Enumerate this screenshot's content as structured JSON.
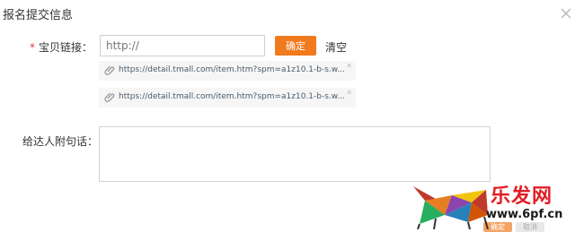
{
  "dialog": {
    "title": "报名提交信息"
  },
  "form": {
    "link_label": "宝贝链接：",
    "required_mark": "*",
    "link_input": {
      "placeholder": "http://",
      "value": ""
    },
    "confirm_label": "确定",
    "clear_label": "清空",
    "links": [
      {
        "url": "https://detail.tmall.com/item.htm?spm=a1z10.1-b-s.w..."
      },
      {
        "url": "https://detail.tmall.com/item.htm?spm=a1z10.1-b-s.w..."
      }
    ],
    "message_label": "给达人附句话："
  },
  "watermark": {
    "title": "乐发网",
    "url": "www.6pf.cn"
  },
  "footer": {
    "confirm_label": "确定",
    "cancel_label": "取消"
  },
  "colors": {
    "accent": "#f17a1d",
    "required": "#e4393c",
    "watermark_red": "#e01e26"
  },
  "icons": {
    "close": "close-icon",
    "attachment": "paperclip-icon"
  }
}
